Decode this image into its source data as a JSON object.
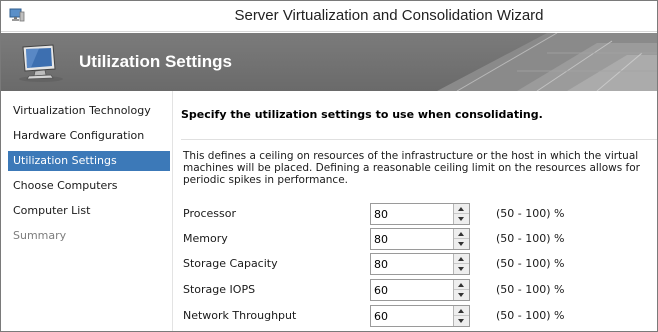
{
  "window": {
    "title": "Server Virtualization and Consolidation Wizard"
  },
  "banner": {
    "title": "Utilization Settings"
  },
  "sidebar": {
    "items": [
      {
        "label": "Virtualization Technology",
        "state": "normal"
      },
      {
        "label": "Hardware Configuration",
        "state": "normal"
      },
      {
        "label": "Utilization Settings",
        "state": "active"
      },
      {
        "label": "Choose Computers",
        "state": "normal"
      },
      {
        "label": "Computer List",
        "state": "normal"
      },
      {
        "label": "Summary",
        "state": "disabled"
      }
    ]
  },
  "main": {
    "heading": "Specify the utilization settings to use when consolidating.",
    "description": "This defines a ceiling on resources of the infrastructure or the host in which the virtual machines will be placed. Defining a reasonable ceiling limit on the resources allows for periodic spikes in performance.",
    "settings": [
      {
        "label": "Processor",
        "value": "80",
        "range": "(50 - 100) %"
      },
      {
        "label": "Memory",
        "value": "80",
        "range": "(50 - 100) %"
      },
      {
        "label": "Storage Capacity",
        "value": "80",
        "range": "(50 - 100) %"
      },
      {
        "label": "Storage IOPS",
        "value": "60",
        "range": "(50 - 100) %"
      },
      {
        "label": "Network Throughput",
        "value": "60",
        "range": "(50 - 100) %"
      }
    ]
  },
  "colors": {
    "active_nav": "#3c79b8",
    "banner": "#727272"
  },
  "icons": {
    "app": "wizard-app-icon",
    "banner": "computer-monitor-icon"
  }
}
